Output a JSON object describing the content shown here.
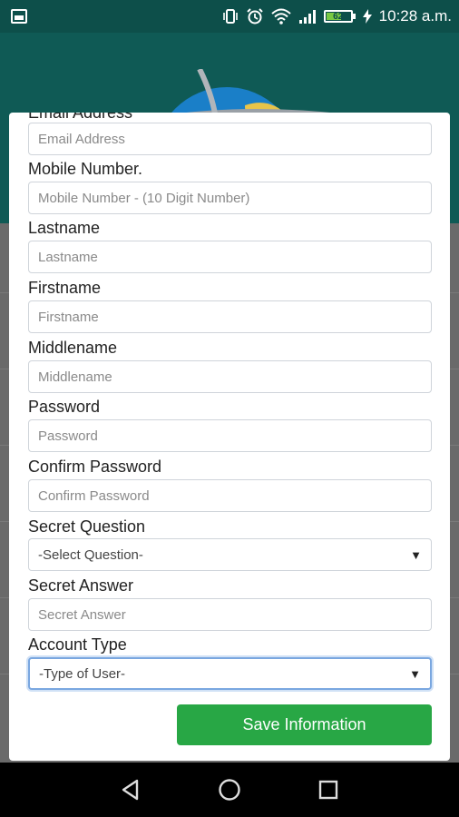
{
  "status_bar": {
    "time": "10:28 a.m.",
    "battery_level": "62",
    "battery_fraction": 0.62,
    "icons": [
      "image-icon",
      "vibrate-icon",
      "alarm-icon",
      "wifi-icon",
      "signal-icon",
      "battery-icon",
      "charging-icon"
    ]
  },
  "form": {
    "email": {
      "label": "Email Address",
      "placeholder": "Email Address"
    },
    "mobile": {
      "label": "Mobile Number.",
      "placeholder": "Mobile Number - (10 Digit Number)"
    },
    "lastname": {
      "label": "Lastname",
      "placeholder": "Lastname"
    },
    "firstname": {
      "label": "Firstname",
      "placeholder": "Firstname"
    },
    "middlename": {
      "label": "Middlename",
      "placeholder": "Middlename"
    },
    "password": {
      "label": "Password",
      "placeholder": "Password"
    },
    "confirm_password": {
      "label": "Confirm Password",
      "placeholder": "Confirm Password"
    },
    "secret_question": {
      "label": "Secret Question",
      "selected": "-Select Question-"
    },
    "secret_answer": {
      "label": "Secret Answer",
      "placeholder": "Secret Answer"
    },
    "account_type": {
      "label": "Account Type",
      "selected": "-Type of User-"
    },
    "save_label": "Save Information"
  },
  "colors": {
    "header": "#0f5a55",
    "status_bar": "#0d4f4a",
    "save_button": "#28a745",
    "focus_border": "#7aa7e0"
  }
}
